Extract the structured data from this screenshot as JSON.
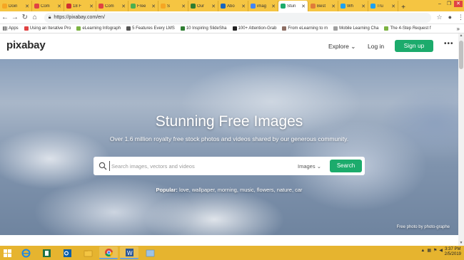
{
  "tabs": [
    {
      "label": "Doin",
      "color": "#f5a623",
      "active": false
    },
    {
      "label": "Com",
      "color": "#e04343",
      "active": false
    },
    {
      "label": "18 F",
      "color": "#d03030",
      "active": false
    },
    {
      "label": "Com",
      "color": "#e04343",
      "active": false
    },
    {
      "label": "Free",
      "color": "#4caf50",
      "active": false
    },
    {
      "label": "S",
      "color": "#f5a623",
      "active": false
    },
    {
      "label": "Our",
      "color": "#2e7d32",
      "active": false
    },
    {
      "label": "Abo",
      "color": "#1565c0",
      "active": false
    },
    {
      "label": "imag",
      "color": "#4285f4",
      "active": false
    },
    {
      "label": "Stun",
      "color": "#1cab6c",
      "active": true
    },
    {
      "label": "Best",
      "color": "#e07b39",
      "active": false
    },
    {
      "label": "Wh",
      "color": "#1da1f2",
      "active": false
    },
    {
      "label": "Tru",
      "color": "#1da1f2",
      "active": false
    }
  ],
  "address": {
    "url": "https://pixabay.com/en/"
  },
  "bookmarks": {
    "apps_label": "Apps",
    "items": [
      {
        "label": "Using an Iterative Pro",
        "color": "#e04343"
      },
      {
        "label": "eLearning Infograph",
        "color": "#7cb342"
      },
      {
        "label": "5 Features Every LMS",
        "color": "#555555"
      },
      {
        "label": "10 Inspiring SlideSha",
        "color": "#2e7d32"
      },
      {
        "label": "100+ Attention-Grab",
        "color": "#222222"
      },
      {
        "label": "From eLearning to m",
        "color": "#8d6e63"
      },
      {
        "label": "Mobile Learning Cha",
        "color": "#9e9e9e"
      },
      {
        "label": "The 4-Step Request f",
        "color": "#7cb342"
      }
    ],
    "more": "»"
  },
  "header": {
    "logo": "pixabay",
    "explore": "Explore",
    "login": "Log in",
    "signup": "Sign up",
    "more": "•••"
  },
  "hero": {
    "title": "Stunning Free Images",
    "subtitle": "Over 1.6 million royalty free stock photos and videos shared by our generous community.",
    "search_placeholder": "Search images, vectors and videos",
    "type_select": "Images",
    "search_button": "Search",
    "popular_label": "Popular:",
    "popular_terms": "love, wallpaper, morning, music, flowers, nature, car",
    "credit": "Free photo by photo-graphe"
  },
  "taskbar": {
    "clock_time": "3:37 PM",
    "clock_date": "2/5/2019"
  }
}
